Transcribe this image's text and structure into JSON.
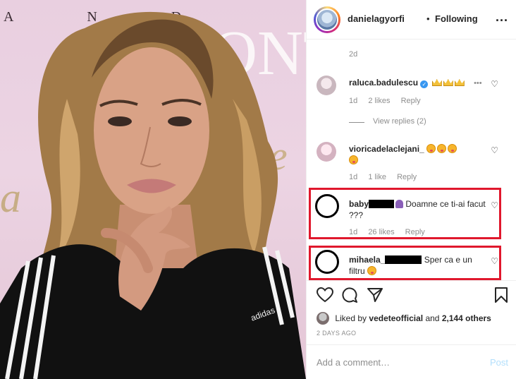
{
  "photo": {
    "sign_letters_top": "A N D",
    "sign_letters_mid": "ONTIN",
    "sign_script": "me",
    "sign_left": "a",
    "shirt_logo": "adidas"
  },
  "header": {
    "username": "danielagyorfi",
    "separator": "•",
    "follow_label": "Following",
    "more": "..."
  },
  "comments": {
    "top_time": "2d",
    "c1": {
      "user": "raluca.badulescu",
      "time": "1d",
      "likes": "2 likes",
      "reply": "Reply"
    },
    "view_replies": "View replies (2)",
    "c2": {
      "user": "viorica.de.la.clejani_",
      "user_display": "vioricadelaclejani_",
      "time": "1d",
      "likes": "1 like",
      "reply": "Reply"
    },
    "c3": {
      "user_prefix": "baby",
      "text": "Doamne ce ti-ai facut ???",
      "time": "1d",
      "likes": "26 likes",
      "reply": "Reply"
    },
    "c4": {
      "user_prefix": "mihaela_",
      "text": "Sper ca e un filtru"
    }
  },
  "likes": {
    "liked_by": "Liked by",
    "liker": "vedeteofficial",
    "and": "and",
    "others": "2,144 others",
    "timestamp": "2 DAYS AGO"
  },
  "add_comment": {
    "placeholder": "Add a comment…",
    "post_label": "Post"
  },
  "colors": {
    "highlight_box": "#e0182d",
    "link_blue": "#3897f0",
    "post_disabled": "#b2dffc"
  }
}
